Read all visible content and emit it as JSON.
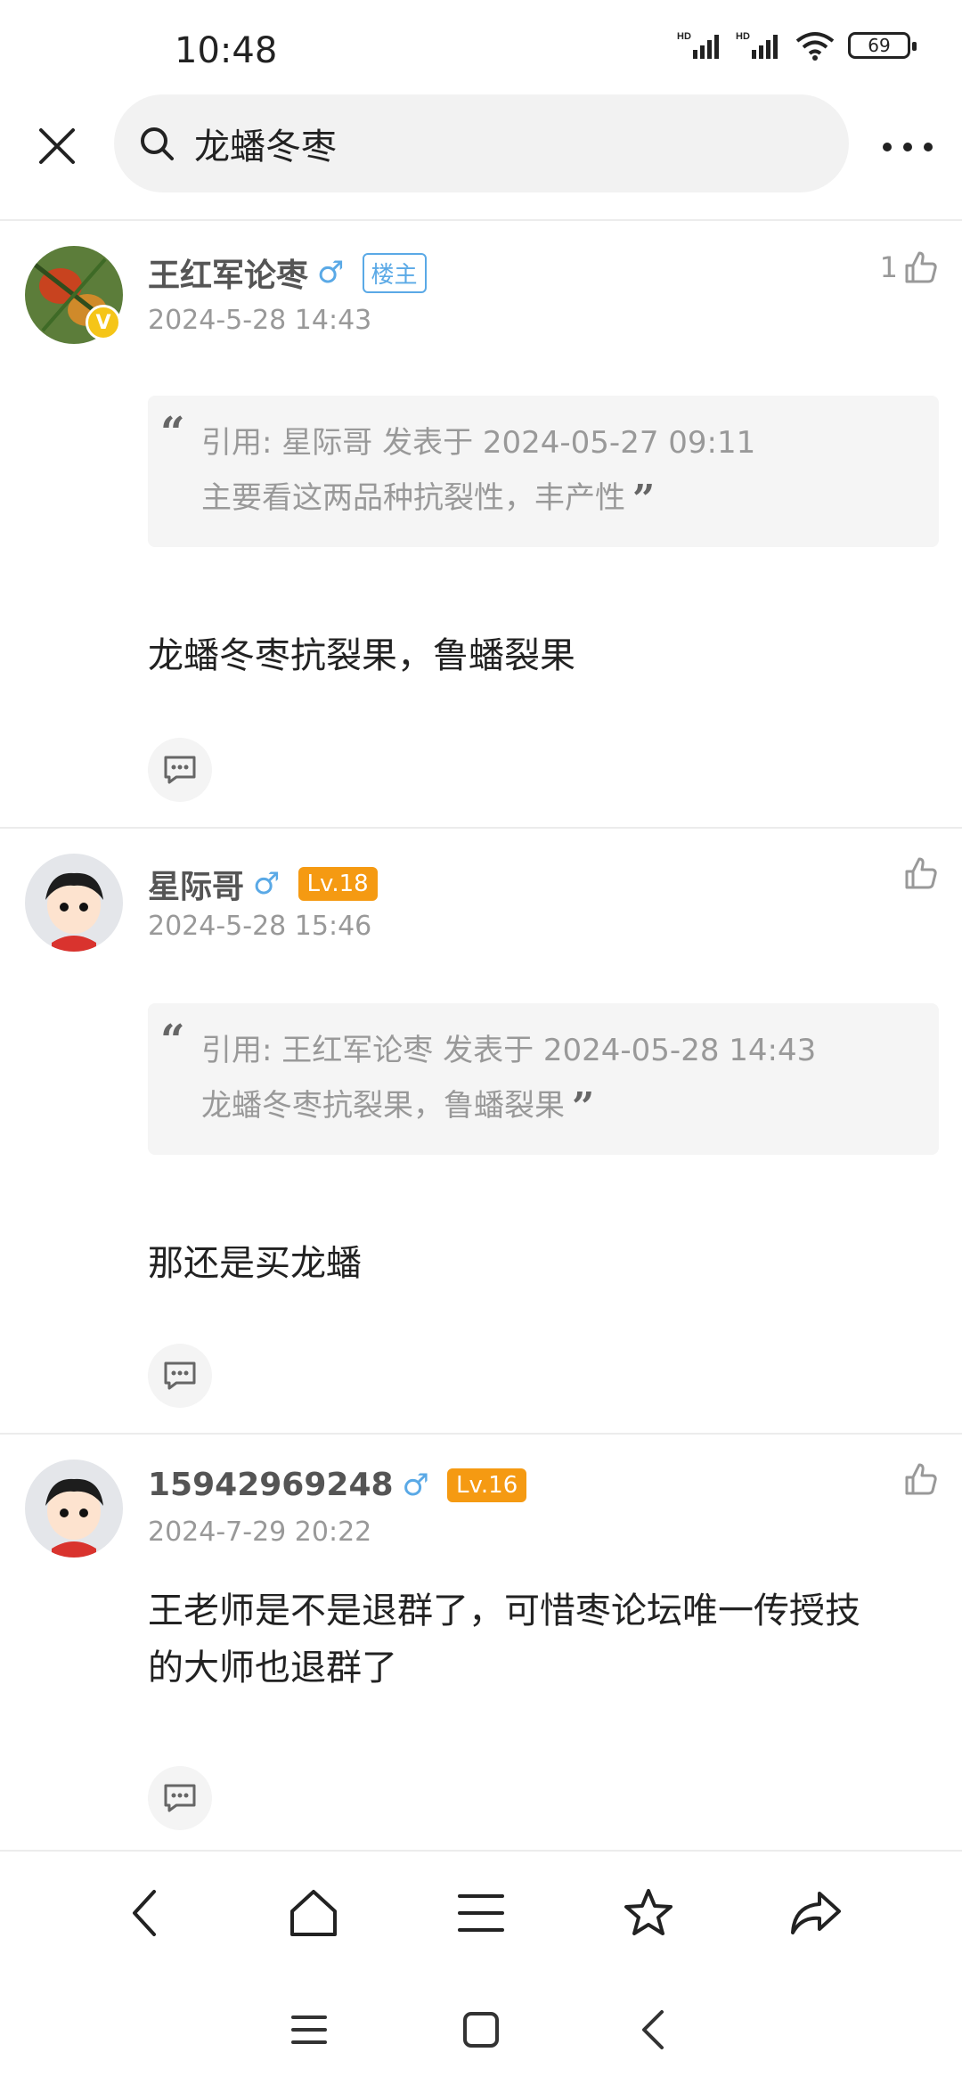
{
  "status_bar": {
    "time": "10:48",
    "battery": "69"
  },
  "search": {
    "query": "龙蟠冬枣"
  },
  "posts": [
    {
      "author": "王红军论枣",
      "gender": "♂",
      "tag": "楼主",
      "time": "2024-5-28 14:43",
      "likes": "1",
      "quote_header": "引用: 星际哥 发表于 2024-05-27 09:11",
      "quote_body": "主要看这两品种抗裂性，丰产性",
      "content": "龙蟠冬枣抗裂果，鲁蟠裂果"
    },
    {
      "author": "星际哥",
      "gender": "♂",
      "tag": "Lv.18",
      "time": "2024-5-28 15:46",
      "quote_header": "引用: 王红军论枣 发表于 2024-05-28 14:43",
      "quote_body": "龙蟠冬枣抗裂果，鲁蟠裂果",
      "content": "那还是买龙蟠"
    },
    {
      "author": "15942969248",
      "gender": "♂",
      "tag": "Lv.16",
      "time": "2024-7-29 20:22",
      "content_line1": "王老师是不是退群了，可惜枣论坛唯一传授技",
      "content_line2": "的大师也退群了"
    }
  ],
  "toolbar_icons": [
    "back-icon",
    "home-icon",
    "menu-icon",
    "star-icon",
    "share-icon"
  ],
  "navbar_icons": [
    "recent-apps-icon",
    "home-square-icon",
    "system-back-icon"
  ],
  "colors": {
    "tag_blue": "#5aa9e6",
    "tag_orange": "#f59a12"
  }
}
